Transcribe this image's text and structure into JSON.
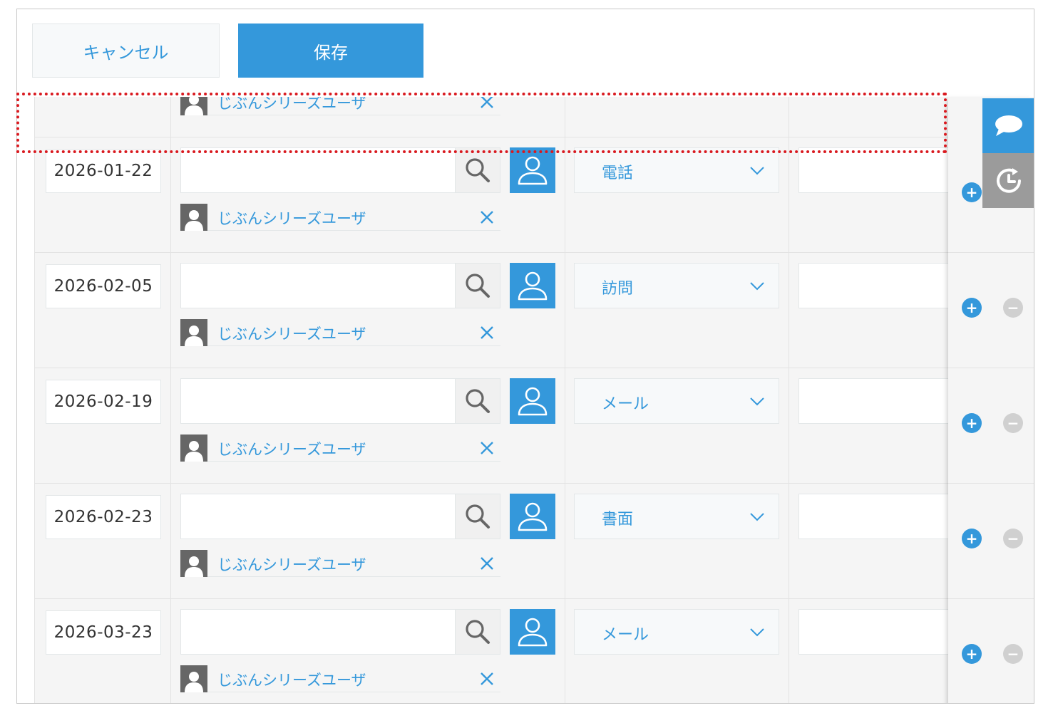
{
  "toolbar": {
    "cancel_label": "キャンセル",
    "save_label": "保存"
  },
  "rows": [
    {
      "user_name": "じぶんシリーズユーザ"
    },
    {
      "date": "2026-01-22",
      "user_name": "じぶんシリーズユーザ",
      "method": "電話"
    },
    {
      "date": "2026-02-05",
      "user_name": "じぶんシリーズユーザ",
      "method": "訪問"
    },
    {
      "date": "2026-02-19",
      "user_name": "じぶんシリーズユーザ",
      "method": "メール"
    },
    {
      "date": "2026-02-23",
      "user_name": "じぶんシリーズユーザ",
      "method": "書面"
    },
    {
      "date": "2026-03-23",
      "user_name": "じぶんシリーズユーザ",
      "method": "メール"
    }
  ],
  "row_actions": {
    "add_symbol": "+",
    "remove_symbol": "−"
  },
  "colors": {
    "accent": "#3498db",
    "highlight": "#d9191f",
    "history_button": "#9b9b9b"
  },
  "icons": {
    "search": "search-icon",
    "user_picker": "user-picker-icon",
    "avatar": "user-avatar-icon",
    "remove": "close-icon",
    "dropdown": "chevron-down-icon",
    "comment": "comment-icon",
    "history": "history-icon"
  }
}
